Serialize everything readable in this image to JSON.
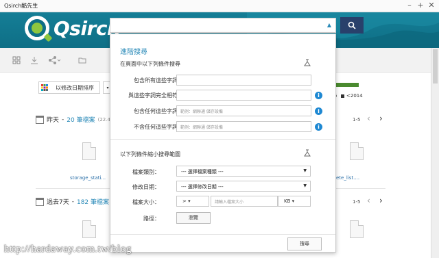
{
  "window": {
    "title": "Qsirch酷先生"
  },
  "window_controls": {
    "minimize": "–",
    "maximize": "+",
    "close": "✕"
  },
  "brand": {
    "logo_text": "Qsirch"
  },
  "search": {
    "value": "",
    "dropdown_glyph": "▲"
  },
  "sort": {
    "label": "以修改日期排序",
    "caret": "▾"
  },
  "legend": {
    "partial_label": "5",
    "label": "<2014",
    "bar_color": "#4a8a2f"
  },
  "groups": [
    {
      "day": "昨天",
      "count": "20 筆檔案",
      "size": "(22.43",
      "pager": "1-5",
      "files": [
        "storage_stati...",
        "ete_list...."
      ]
    },
    {
      "day": "過去7天",
      "count": "182 筆檔案",
      "size": "",
      "pager": "1-5",
      "files": []
    }
  ],
  "panel": {
    "title": "進階搜尋",
    "section1": "在頁面中以下列條件搜尋",
    "labels": {
      "all": "包含所有這些字詞",
      "exact": "與這些字詞完全相符",
      "any": "包含任何這些字詞",
      "none": "不含任何這些字詞"
    },
    "placeholders": {
      "any": "範例：網聯通 儲存設備",
      "none": "範例：網聯通 儲存設備"
    },
    "section2": "以下列條件縮小搜尋範圍",
    "type_label": "檔案類別：",
    "type_value": "--- 選擇檔案種類 ---",
    "date_label": "修改日期：",
    "date_value": "--- 選擇修改日期 ---",
    "size_label": "檔案大小：",
    "size_op": ">",
    "size_placeholder": "請輸入檔案大小",
    "size_unit": "KB",
    "path_label": "路徑：",
    "browse": "瀏覽",
    "submit": "搜尋"
  },
  "watermark": "http://hardaway.com.tw/blog",
  "colors": {
    "header": "#127a92",
    "accent": "#2a8ab8",
    "search_button": "#28406b",
    "info": "#1e88d2",
    "logo_green": "#8dc63f"
  }
}
